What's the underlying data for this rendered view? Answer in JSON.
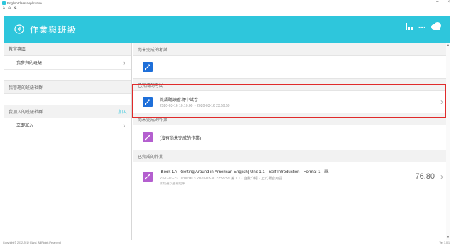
{
  "window": {
    "title": "EnglishClass application",
    "menu": [
      "ꝺ",
      "⊖",
      "⊗"
    ],
    "controls": [
      "–",
      "×"
    ]
  },
  "header": {
    "title": "作業與班級",
    "status_text": "■ ■ ■",
    "bg_color": "#2ec6dc"
  },
  "left": {
    "sections": [
      {
        "label": "教室專區",
        "items": [
          {
            "label": "我參與的班級",
            "chevron": "›"
          }
        ]
      },
      {
        "label": "我管理的班級社群",
        "items": []
      },
      {
        "label": "我加入的班級社群",
        "join": "加入",
        "items": [
          {
            "label": "立即加入",
            "chevron": "›"
          }
        ]
      }
    ]
  },
  "right": {
    "sections": [
      {
        "header": "尚未完成的考試",
        "rows": []
      },
      {
        "header": "已完成的考試",
        "rows": [
          {
            "title": "英語聽讀看寫中試卷",
            "sub": "2020-03-16 10:10:00 ~ 2020-03-16 23:59:59",
            "chevron": "›"
          }
        ]
      },
      {
        "header": "尚未完成的作業",
        "rows": [
          {
            "title": "(沒有尚未完成的作業)"
          }
        ]
      },
      {
        "header": "已完成的作業",
        "rows": [
          {
            "title": "[Book 1A - Getting Around in American English] Unit 1.1 - Self Introduction - Formal 1 - 單",
            "sub": "2020-03-23 10:00:00 ~ 2020-03-30 23:59:59   第 1.1 - 自我介紹 - 正式場合用語",
            "sub2": "請點選以查看結果",
            "score": "76.80",
            "chevron": "›"
          }
        ]
      }
    ]
  },
  "footer": {
    "left": "Copyright © 2012-2019 Eland. All Rights Reserved.",
    "right": "Ver 1.0.1"
  }
}
